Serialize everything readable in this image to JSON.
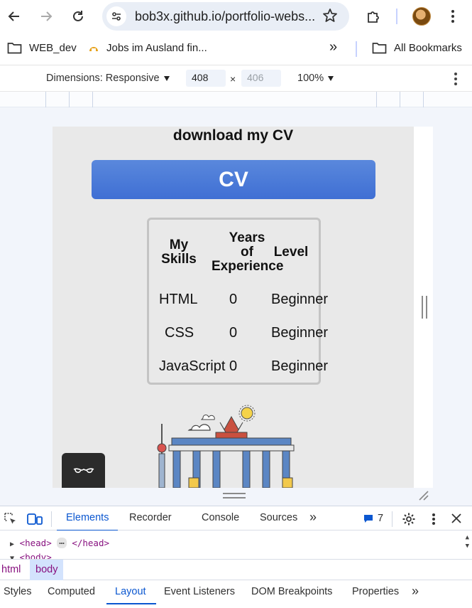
{
  "browser": {
    "url": "bob3x.github.io/portfolio-webs...",
    "bookmarks": [
      {
        "label": "WEB_dev",
        "icon": "folder-icon"
      },
      {
        "label": "Jobs im Ausland fin...",
        "icon": "site-favicon-icon"
      }
    ],
    "overflow_label": "»",
    "all_bookmarks": "All Bookmarks"
  },
  "device_toolbar": {
    "dimensions_label": "Dimensions: Responsive",
    "width_value": "408",
    "height_placeholder": "406",
    "times": "×",
    "zoom": "100%"
  },
  "page": {
    "heading": "download my CV",
    "cv_button": "CV",
    "skills_table": {
      "headers": [
        [
          "My",
          "Skills"
        ],
        [
          "Years",
          "of",
          "Experience"
        ],
        [
          "Level"
        ]
      ],
      "rows": [
        {
          "skill": "HTML",
          "years": "0",
          "level": "Beginner"
        },
        {
          "skill": "CSS",
          "years": "0",
          "level": "Beginner"
        },
        {
          "skill": "JavaScript",
          "years": "0",
          "level": "Beginner"
        }
      ]
    }
  },
  "devtools": {
    "tabs": [
      "Elements",
      "Recorder",
      "Console",
      "Sources"
    ],
    "active_tab": "Elements",
    "issues_count": "7",
    "dom_lines": {
      "head_open": "<head>",
      "head_ellipsis": "⋯",
      "head_close": "</head>",
      "body_open": "<body>"
    },
    "breadcrumbs": [
      "html",
      "body"
    ],
    "subtabs": [
      "Styles",
      "Computed",
      "Layout",
      "Event Listeners",
      "DOM Breakpoints",
      "Properties"
    ],
    "active_subtab": "Layout"
  },
  "colors": {
    "accent": "#0b57d0",
    "cv_button": "#4a7bd8",
    "page_bg": "#e9e9e9"
  }
}
